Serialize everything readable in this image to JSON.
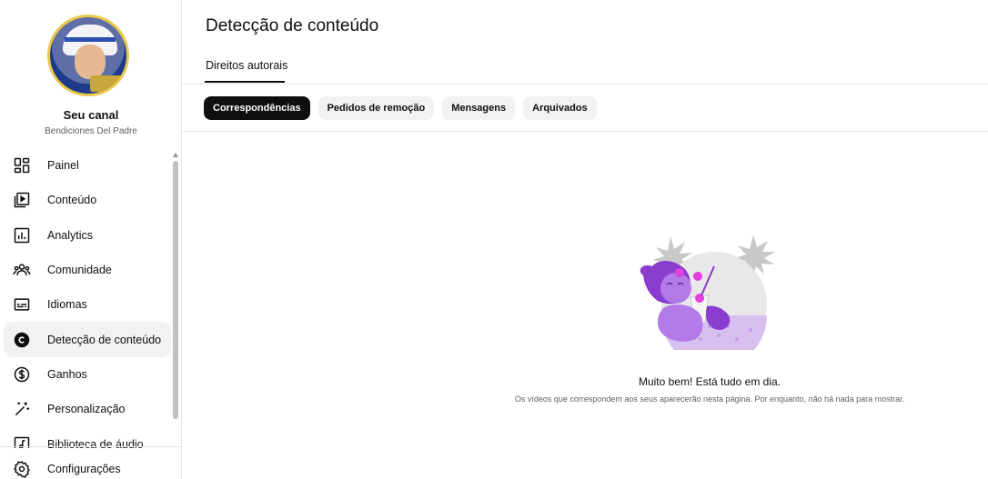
{
  "sidebar": {
    "channel_title": "Seu canal",
    "channel_name": "Bendiciones Del Padre",
    "items": [
      {
        "label": "Painel",
        "icon": "dashboard-icon"
      },
      {
        "label": "Conteúdo",
        "icon": "content-icon"
      },
      {
        "label": "Analytics",
        "icon": "analytics-icon"
      },
      {
        "label": "Comunidade",
        "icon": "community-icon"
      },
      {
        "label": "Idiomas",
        "icon": "subtitles-icon"
      },
      {
        "label": "Detecção de conteúdo",
        "icon": "copyright-icon",
        "active": true
      },
      {
        "label": "Ganhos",
        "icon": "dollar-icon"
      },
      {
        "label": "Personalização",
        "icon": "magic-wand-icon"
      },
      {
        "label": "Biblioteca de áudio",
        "icon": "audio-library-icon"
      }
    ],
    "settings_label": "Configurações"
  },
  "header": {
    "title": "Detecção de conteúdo",
    "tab": "Direitos autorais"
  },
  "chips": [
    {
      "label": "Correspondências",
      "active": true
    },
    {
      "label": "Pedidos de remoção",
      "active": false
    },
    {
      "label": "Mensagens",
      "active": false
    },
    {
      "label": "Arquivados",
      "active": false
    }
  ],
  "empty_state": {
    "title": "Muito bem! Está tudo em dia.",
    "subtitle": "Os vídeos que correspondem aos seus aparecerão nesta página. Por enquanto, não há nada para mostrar."
  },
  "colors": {
    "accent": "#0f0f0f",
    "illustration_purple": "#8a3ccf",
    "illustration_pink": "#e23ee0"
  }
}
